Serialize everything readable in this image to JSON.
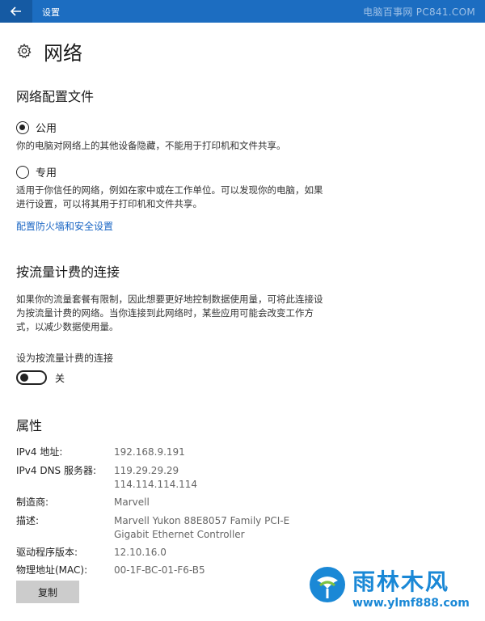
{
  "titlebar": {
    "title": "设置",
    "watermark": "电脑百事网 PC841.COM"
  },
  "header": {
    "title": "网络"
  },
  "profile": {
    "title": "网络配置文件",
    "options": [
      {
        "label": "公用",
        "selected": true,
        "description": "你的电脑对网络上的其他设备隐藏，不能用于打印机和文件共享。"
      },
      {
        "label": "专用",
        "selected": false,
        "description": "适用于你信任的网络，例如在家中或在工作单位。可以发现你的电脑，如果进行设置，可以将其用于打印机和文件共享。"
      }
    ],
    "firewall_link": "配置防火墙和安全设置"
  },
  "metered": {
    "title": "按流量计费的连接",
    "description": "如果你的流量套餐有限制，因此想要更好地控制数据使用量，可将此连接设为按流量计费的网络。当你连接到此网络时，某些应用可能会改变工作方式，以减少数据使用量。",
    "toggle_label": "设为按流量计费的连接",
    "toggle_state_text": "关",
    "toggle_on": false
  },
  "properties": {
    "title": "属性",
    "items": [
      {
        "key": "IPv4 地址:",
        "value": "192.168.9.191"
      },
      {
        "key": "IPv4 DNS 服务器:",
        "value": "119.29.29.29\n114.114.114.114"
      },
      {
        "key": "制造商:",
        "value": "Marvell"
      },
      {
        "key": "描述:",
        "value": "Marvell Yukon 88E8057 Family PCI-E Gigabit Ethernet Controller"
      },
      {
        "key": "驱动程序版本:",
        "value": "12.10.16.0"
      },
      {
        "key": "物理地址(MAC):",
        "value": "00-1F-BC-01-F6-B5"
      }
    ],
    "copy_label": "复制"
  },
  "watermark_logo": {
    "text": "雨林木风",
    "url": "www.ylmf888.com"
  },
  "colors": {
    "titlebar": "#1c6dc1",
    "link": "#1a66c4",
    "logo": "#1a88d6"
  },
  "icons": {
    "back": "back-arrow-icon",
    "settings": "gear-icon"
  }
}
